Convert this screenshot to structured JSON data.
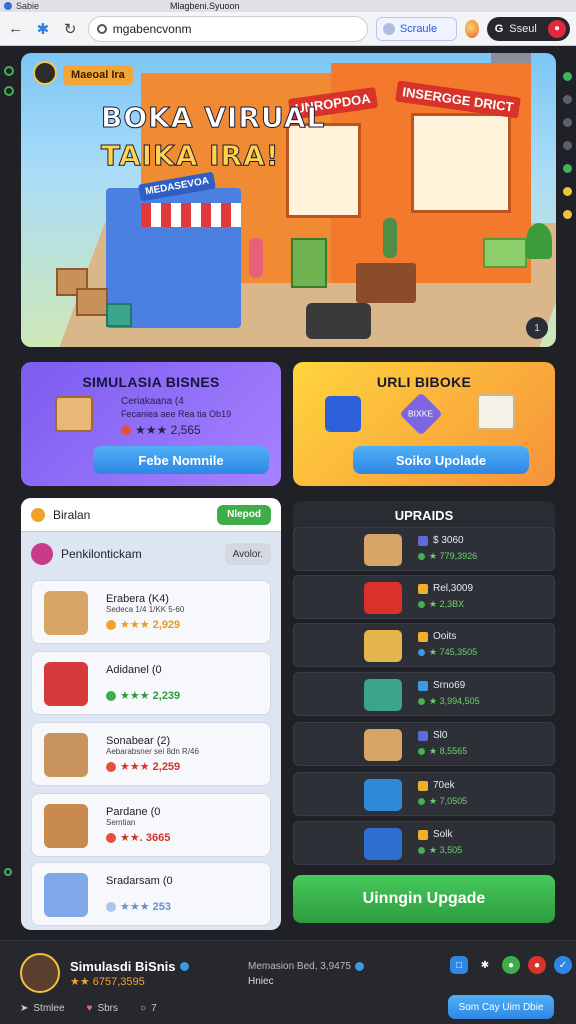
{
  "browser": {
    "tab_title": "Sabie",
    "window_title": "Mlagbeni.Syuoon",
    "url": "mgabencvonm",
    "search_label": "Scraule",
    "account_label": "Sseul",
    "account_g": "G"
  },
  "hero": {
    "tag": "Maeoal Ira",
    "title_line1": "BOKA VIRUAL",
    "title_line2": "TAIKA IRA!",
    "sign_left": "MEDASEVOA",
    "sign_mid": "UNROPDOA",
    "sign_right": "INSERGGE DRICT",
    "counter": "1"
  },
  "card_left": {
    "title": "SIMULASIA BISNES",
    "subtitle": "Ceriakaana (4",
    "detail": "Fecaniea aee Rea tia Ob19",
    "stars": "★★★ 2,565",
    "button": "Febe Nomnile"
  },
  "card_right": {
    "title": "URLI BIBOKE",
    "badge": "BIXKE",
    "button": "Soiko Upolade"
  },
  "list_panel": {
    "header_label": "Biralan",
    "header_badge": "Nlepod",
    "sub_label": "Penkilontickam",
    "sub_chip": "Avolor.",
    "items": [
      {
        "name": "Erabera (K4)",
        "desc": "Sedeca 1/4 1/KK 5-60",
        "price": "★★★ 2,929",
        "coin": "orange"
      },
      {
        "name": "Adidanel (0",
        "desc": "",
        "price": "★★★ 2,239",
        "coin": "green"
      },
      {
        "name": "Sonabear (2)",
        "desc": "Aebarabsner sei 8dn R/46",
        "price": "★★★ 2,259",
        "coin": "red"
      },
      {
        "name": "Pardane (0",
        "desc": "Semtian",
        "price": "★★. 3665",
        "coin": "red"
      },
      {
        "name": "Sradarsam (0",
        "desc": "",
        "price": "★★★ 253",
        "coin": "blue"
      }
    ]
  },
  "upgrades": {
    "title": "UPRAIDS",
    "rows": [
      {
        "line1": "$ 3060",
        "line2": "★ 779,3926"
      },
      {
        "line1": "Rel,3009",
        "line2": "★ 2,3BX"
      },
      {
        "line1": "Ooits",
        "line2": "★ 745,3505"
      },
      {
        "line1": "Srno69",
        "line2": "★ 3,994,505"
      },
      {
        "line1": "Sl0",
        "line2": "★ 8,5565"
      },
      {
        "line1": "70ek",
        "line2": "★ 7,0505"
      },
      {
        "line1": "Solk",
        "line2": "★ 3,505"
      }
    ],
    "big_button": "Uinngin Upgade"
  },
  "footer": {
    "name": "Simulasdi BiSnis",
    "score": "★★ 6757,3595",
    "mid_line1": "Memasion Bed, 3,9475",
    "mid_line2": "Hniec",
    "link1": "Stmlee",
    "link2": "Sbrs",
    "link3": "7",
    "button": "Som Cay Uim Dbie"
  }
}
